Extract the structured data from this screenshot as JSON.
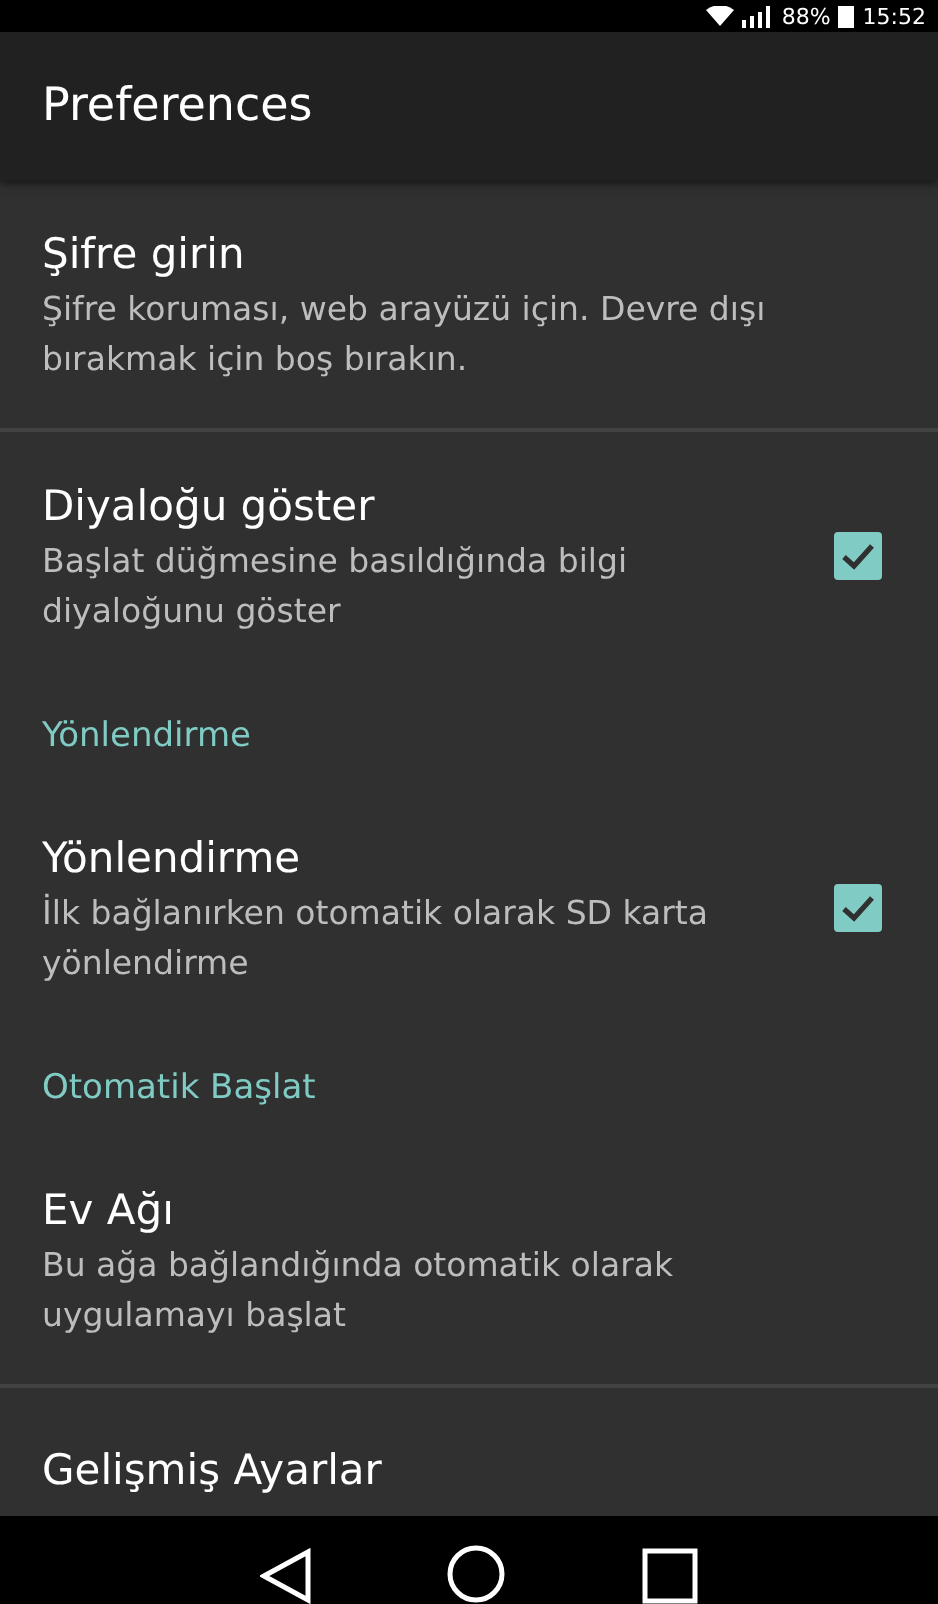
{
  "status_bar": {
    "battery": "88%",
    "time": "15:52"
  },
  "toolbar": {
    "title": "Preferences"
  },
  "items": [
    {
      "kind": "preference",
      "title": "Şifre girin",
      "summary": "Şifre koruması, web arayüzü için. Devre dışı bırakmak için boş bırakın."
    },
    {
      "kind": "checkbox",
      "title": "Diyaloğu göster",
      "summary": "Başlat düğmesine basıldığında bilgi diyaloğunu göster",
      "checked": true
    },
    {
      "kind": "category",
      "title": "Yönlendirme"
    },
    {
      "kind": "checkbox",
      "title": "Yönlendirme",
      "summary": "İlk bağlanırken otomatik olarak SD karta yönlendirme",
      "checked": true
    },
    {
      "kind": "category",
      "title": "Otomatik Başlat"
    },
    {
      "kind": "preference",
      "title": "Ev Ağı",
      "summary": "Bu ağa bağlandığında otomatik olarak uygulamayı başlat"
    },
    {
      "kind": "preference",
      "title": "Gelişmiş Ayarlar"
    }
  ]
}
